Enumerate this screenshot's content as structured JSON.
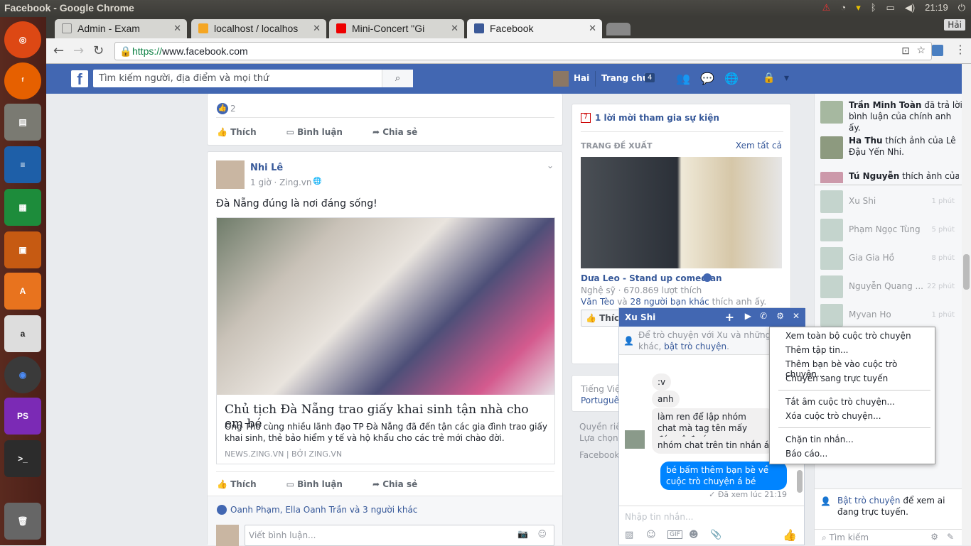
{
  "os": {
    "window_title": "Facebook - Google Chrome",
    "time": "21:19"
  },
  "chrome": {
    "tabs": [
      {
        "label": "Admin - Exam"
      },
      {
        "label": "localhost / localhos"
      },
      {
        "label": "Mini-Concert \"Gi"
      },
      {
        "label": "Facebook"
      }
    ],
    "user_badge": "Hải",
    "url_scheme": "https://",
    "url_host": "www.facebook.com"
  },
  "fb_header": {
    "search_placeholder": "Tìm kiếm người, địa điểm và mọi thứ",
    "profile_name": "Hai",
    "home_label": "Trang chủ",
    "home_count": "4"
  },
  "post_top": {
    "like_count": "2",
    "like_label": "Thích",
    "comment_label": "Bình luận",
    "share_label": "Chia sẻ"
  },
  "post": {
    "author": "Nhi Lê",
    "meta": "1 giờ · Zing.vn ·",
    "text": "Đà Nẵng đúng là nơi đáng sống!",
    "link_title": "Chủ tịch Đà Nẵng trao giấy khai sinh tận nhà cho em bé",
    "link_desc": "Ông Thơ cùng nhiều lãnh đạo TP Đà Nẵng đã đến tận các gia đình trao giấy khai sinh, thẻ bảo hiểm y tế và hộ khẩu cho các trẻ mới chào đời.",
    "link_source": "NEWS.ZING.VN",
    "link_author": "BỞI ZING.VN",
    "like_label": "Thích",
    "comment_label": "Bình luận",
    "share_label": "Chia sẻ",
    "likers": "Oanh Phạm, Ella Oanh Trần và 3 người khác",
    "comment_placeholder": "Viết bình luận..."
  },
  "right_col": {
    "event_invite": "1 lời mời tham gia sự kiện",
    "suggest_header": "TRANG ĐỀ XUẤT",
    "see_all": "Xem tất cả",
    "page_name": "Dưa Leo - Stand up comedian",
    "page_meta": "Nghệ sỹ · 670.869 lượt thích",
    "page_friends_a": "Văn Tèo",
    "page_friends_b": "và",
    "page_friends_c": "28 người bạn khác",
    "page_friends_d": "thích anh ấy.",
    "like_btn": "Thích",
    "lang_a": "Tiếng Việt",
    "lang_b": "Portuguê",
    "foot_a": "Quyền riê",
    "foot_b": "Lựa chọn",
    "foot_c": "Facebook"
  },
  "ticker": [
    {
      "name": "Trần Minh Toàn",
      "text": "đã trả lời bình luận của chính anh ấy."
    },
    {
      "name": "Ha Thu",
      "text": "thích ảnh của Lê Đậu Yến Nhi."
    },
    {
      "name": "Tú Nguyễn",
      "text": "thích ảnh của"
    }
  ],
  "friends": [
    {
      "name": "Xu Shi",
      "mins": "1 phút"
    },
    {
      "name": "Phạm Ngọc Tùng",
      "mins": "5 phút"
    },
    {
      "name": "Gia Gia Hồ",
      "mins": "8 phút"
    },
    {
      "name": "Nguyễn Quang ...",
      "mins": "22 phút"
    },
    {
      "name": "Myvan Ho",
      "mins": "1 phút"
    }
  ],
  "sidebar_footer": {
    "chat_link": "Bật trò chuyện",
    "chat_text": "để xem ai đang trực tuyến.",
    "search": "Tìm kiếm"
  },
  "chat": {
    "name": "Xu Shi",
    "notice_a": "Để trò chuyện với Xu và những bạ",
    "notice_b": "khác,",
    "notice_link": "bật trò chuyện",
    "messages": [
      ":v",
      "anh",
      "làm ren để lập nhóm chat mà tag tên mấy đứa vô đc á",
      "nhóm chat trên tin nhắn á"
    ],
    "my_message": "bé bấm thêm bạn bè về cuộc trò chuyện á bé",
    "seen": "Đã xem lúc 21:19",
    "input_placeholder": "Nhập tin nhắn..."
  },
  "menu": {
    "items_a": [
      "Xem toàn bộ cuộc trò chuyện",
      "Thêm tập tin...",
      "Thêm bạn bè vào cuộc trò chuyện...",
      "Chuyển sang trực tuyến"
    ],
    "items_b": [
      "Tắt âm cuộc trò chuyện...",
      "Xóa cuộc trò chuyện..."
    ],
    "items_c": [
      "Chặn tin nhắn...",
      "Báo cáo..."
    ]
  }
}
